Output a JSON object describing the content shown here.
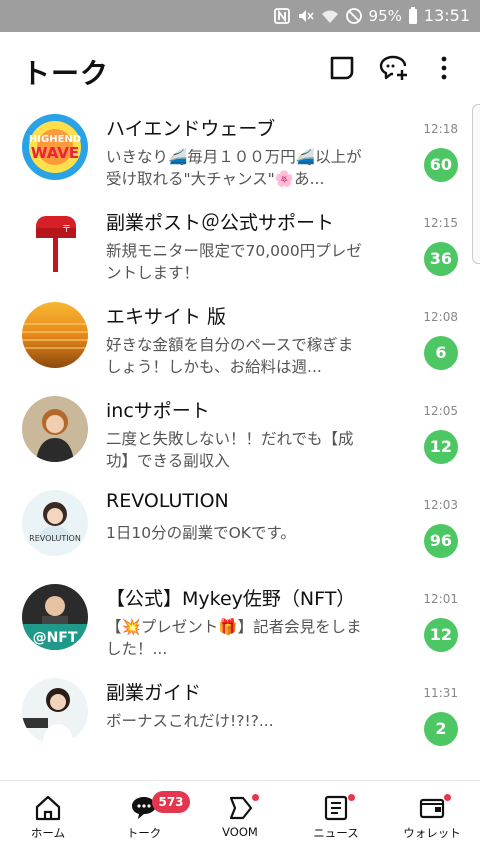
{
  "status_bar": {
    "battery": "95%",
    "time": "13:51",
    "icons": [
      "nfc-icon",
      "mute-icon",
      "wifi-icon",
      "no-entry-icon",
      "battery-icon"
    ]
  },
  "header": {
    "title": "トーク",
    "buttons": [
      "search-chat-icon",
      "new-chat-icon",
      "more-menu-icon"
    ]
  },
  "chats": [
    {
      "name": "ハイエンドウェーブ",
      "preview": "いきなり🚄毎月１００万円🚄以上が受け取れる\"大チャンス\"🌸あ...",
      "time": "12:18",
      "unread": "60",
      "avatar": "highend-wave-logo"
    },
    {
      "name": "副業ポスト＠公式サポート",
      "preview": "新規モニター限定で70,000円プレゼントします！",
      "time": "12:15",
      "unread": "36",
      "avatar": "red-mailbox"
    },
    {
      "name": "エキサイト 版",
      "preview": "好きな金額を自分のペースで稼ぎましょう！しかも、お給料は週...",
      "time": "12:08",
      "unread": "6",
      "avatar": "sunset-water"
    },
    {
      "name": "incサポート",
      "preview": "二度と失敗しない！！だれでも【成功】できる副収入",
      "time": "12:05",
      "unread": "12",
      "avatar": "woman-portrait"
    },
    {
      "name": "REVOLUTION",
      "preview": "1日10分の副業でOKです。",
      "time": "12:03",
      "unread": "96",
      "avatar": "revolution-logo"
    },
    {
      "name": "【公式】Mykey佐野（NFT）",
      "preview": "【💥プレゼント🎁】記者会見をしました！...",
      "time": "12:01",
      "unread": "12",
      "avatar": "nft-logo"
    },
    {
      "name": "副業ガイド",
      "preview": "ボーナスこれだけ!?!?...",
      "time": "11:31",
      "unread": "2",
      "avatar": "guide-portrait"
    }
  ],
  "bottom_nav": [
    {
      "label": "ホーム",
      "icon": "home-icon"
    },
    {
      "label": "トーク",
      "icon": "chat-icon",
      "badge": "573"
    },
    {
      "label": "VOOM",
      "icon": "voom-icon",
      "dot": true
    },
    {
      "label": "ニュース",
      "icon": "news-icon",
      "dot": true
    },
    {
      "label": "ウォレット",
      "icon": "wallet-icon",
      "dot": true
    }
  ],
  "colors": {
    "accent_green": "#4cc764",
    "badge_red": "#e53650",
    "status_bar": "#9e9e9e"
  }
}
